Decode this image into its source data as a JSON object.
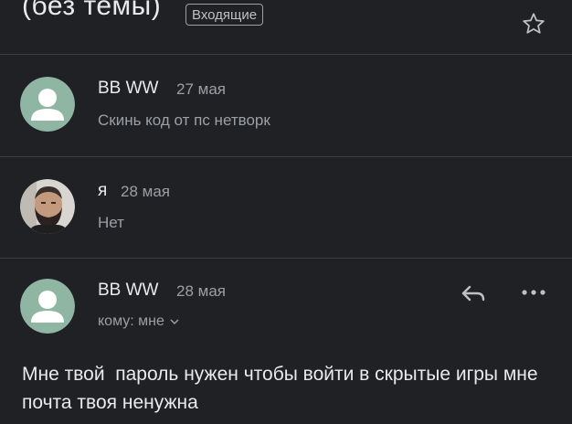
{
  "thread": {
    "subject": "(без темы)",
    "label": "Входящие"
  },
  "icons": {
    "star": "star-outline-icon",
    "reply": "reply-icon",
    "more": "more-horizontal-icon",
    "chevron": "chevron-down-icon"
  },
  "colors": {
    "background": "#202124",
    "avatar_default": "#8fb5a3",
    "text_primary": "#e8eaed",
    "text_secondary": "#9aa0a6"
  },
  "messages": [
    {
      "sender": "BB WW",
      "date": "27 мая",
      "snippet": "Скинь код от пс нетворк",
      "avatar": "default-person-avatar"
    },
    {
      "sender": "я",
      "date": "28 мая",
      "snippet": "Нет",
      "avatar": "photo-avatar"
    },
    {
      "sender": "BB WW",
      "date": "28 мая",
      "to": "кому: мне",
      "avatar": "default-person-avatar",
      "body": "Мне твой  пароль нужен чтобы войти в скрытые игры мне почта твоя ненужна"
    }
  ]
}
